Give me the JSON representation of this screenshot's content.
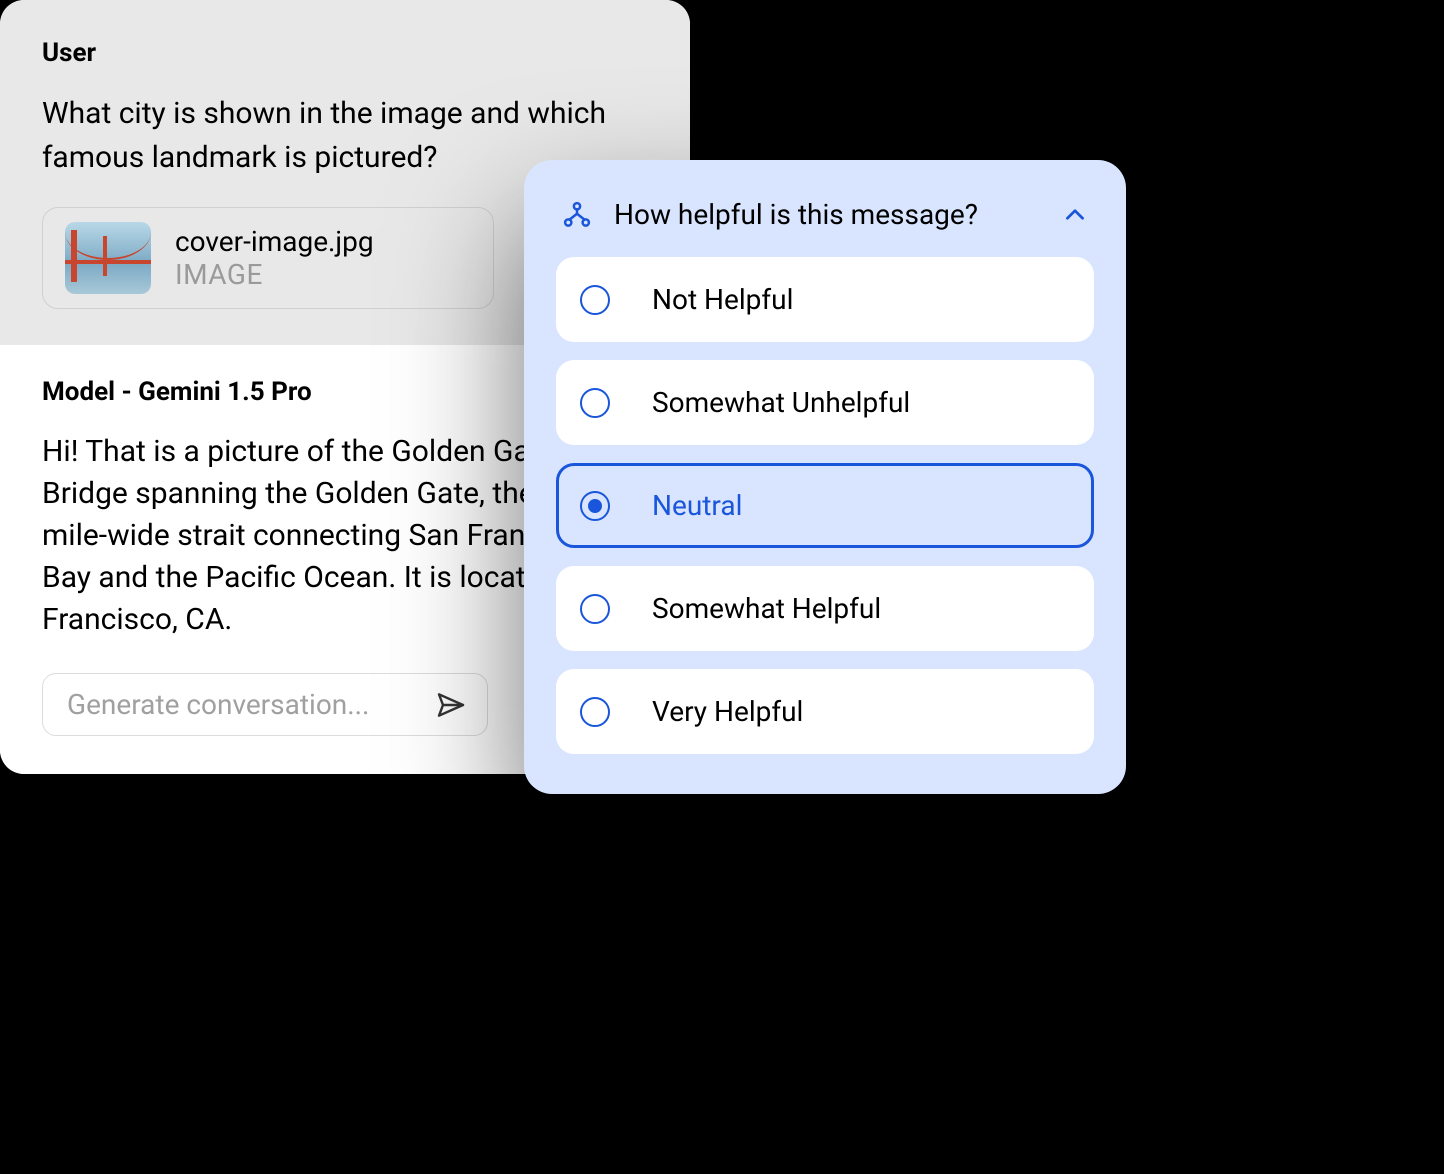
{
  "conversation": {
    "user_label": "User",
    "question": "What city is shown in the image and which famous landmark is pictured?",
    "attachment": {
      "name": "cover-image.jpg",
      "type": "IMAGE"
    },
    "model_label": "Model - Gemini 1.5 Pro",
    "response": "Hi! That is a picture of the Golden Gate Bridge spanning the Golden Gate, the one-mile-wide strait connecting San Francisco Bay and the Pacific Ocean. It is located in San Francisco, CA.",
    "input_placeholder": "Generate conversation..."
  },
  "rating": {
    "title": "How helpful is this message?",
    "options": [
      {
        "label": "Not Helpful",
        "selected": false
      },
      {
        "label": "Somewhat Unhelpful",
        "selected": false
      },
      {
        "label": "Neutral",
        "selected": true
      },
      {
        "label": "Somewhat Helpful",
        "selected": false
      },
      {
        "label": "Very Helpful",
        "selected": false
      }
    ]
  }
}
